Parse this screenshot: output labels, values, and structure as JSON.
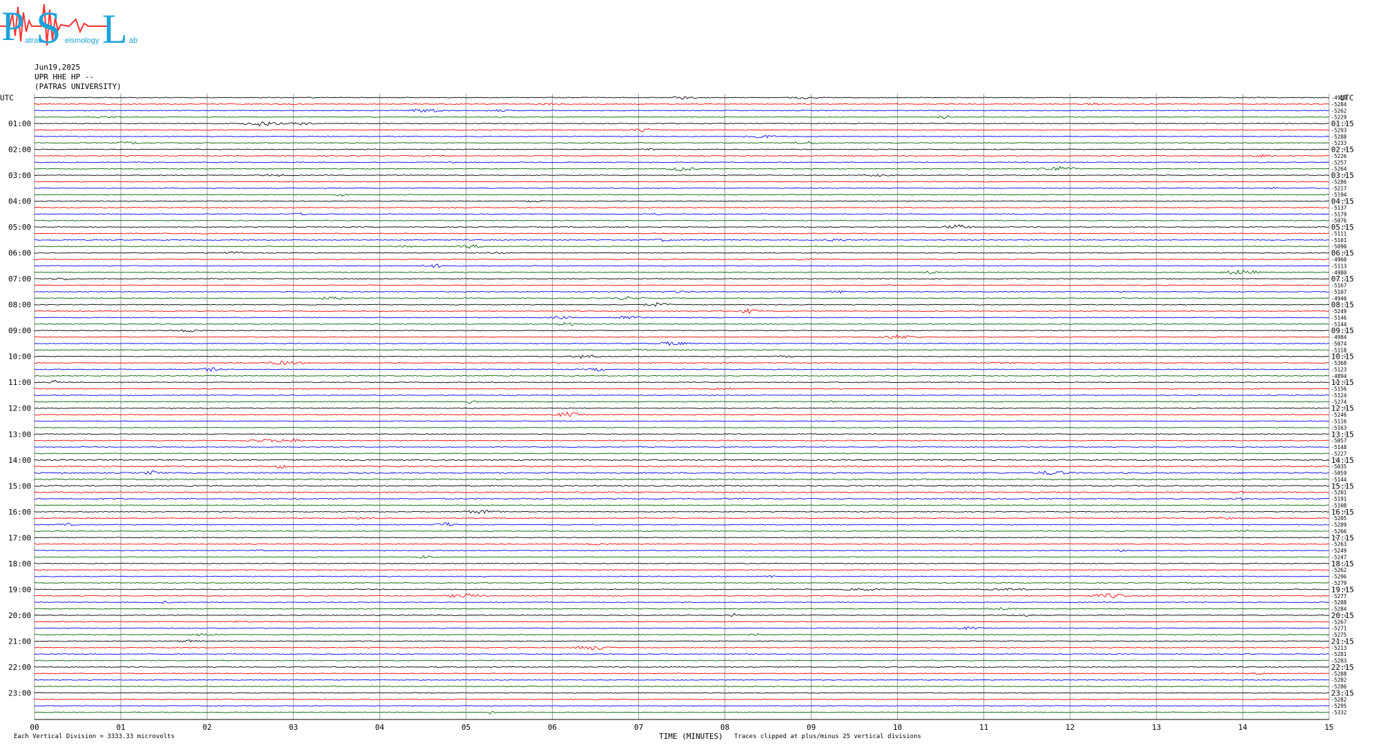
{
  "header": {
    "logo_letters": [
      "P",
      "S",
      "L"
    ],
    "logo_words": [
      "atras",
      "eismology",
      "ab"
    ],
    "date": "Jun19,2025",
    "station": "UPR HHE HP --",
    "institution": "(PATRAS UNIVERSITY)"
  },
  "footer": {
    "division_note": "Each Vertical Division = 3333.33 microvolts",
    "x_title": "TIME (MINUTES)",
    "clip_note": "Traces clipped at plus/minus 25 vertical divisions"
  },
  "colors": {
    "black": "#000000",
    "red": "#ff0000",
    "blue": "#0000ff",
    "green": "#006400",
    "grid": "#9a9a9a",
    "logo_blue": "#1aa3d9",
    "logo_red": "#ff3333"
  },
  "chart_data": {
    "type": "line",
    "title": "",
    "xlabel": "TIME (MINUTES)",
    "ylabel": "UTC",
    "xlim": [
      0,
      15
    ],
    "x_ticks": [
      "00",
      "01",
      "02",
      "03",
      "04",
      "05",
      "06",
      "07",
      "08",
      "09",
      "10",
      "11",
      "12",
      "13",
      "14",
      "15"
    ],
    "left_axis_label": "UTC",
    "right_axis_label": "UTC",
    "left_hour_labels": [
      "01:00",
      "02:00",
      "03:00",
      "04:00",
      "05:00",
      "06:00",
      "07:00",
      "08:00",
      "09:00",
      "10:00",
      "11:00",
      "12:00",
      "13:00",
      "14:00",
      "15:00",
      "16:00",
      "17:00",
      "18:00",
      "19:00",
      "20:00",
      "21:00",
      "22:00",
      "23:00"
    ],
    "right_hour_labels": [
      "01:15",
      "02:15",
      "03:15",
      "04:15",
      "05:15",
      "06:15",
      "07:15",
      "08:15",
      "09:15",
      "10:15",
      "11:15",
      "12:15",
      "13:15",
      "14:15",
      "15:15",
      "16:15",
      "17:15",
      "18:15",
      "19:15",
      "20:15",
      "21:15",
      "22:15",
      "23:15"
    ],
    "trace_color_cycle": [
      "black",
      "red",
      "blue",
      "green"
    ],
    "trace_count": 96,
    "trace_offsets": [
      "-4919",
      "-5284",
      "-5262",
      "-5229",
      "-5253",
      "-5293",
      "-5288",
      "-5233",
      "-5258",
      "-5226",
      "-5257",
      "-5264",
      "-5248",
      "-5286",
      "-5217",
      "-5194",
      "-5165",
      "-5137",
      "-5179",
      "-5076",
      "-5135",
      "-5111",
      "-5101",
      "-5090",
      "-5026",
      "-4960",
      "-5113",
      "-4980",
      "-5112",
      "-5167",
      "-5107",
      "-4940",
      "-5161",
      "-5249",
      "-5146",
      "-5144",
      "-5023",
      "-4984",
      "-5074",
      "-5118",
      "-5079",
      "-5368",
      "-5123",
      "-4894",
      "-4930",
      "-5156",
      "-5124",
      "-5274",
      "-5098",
      "-5246",
      "-5116",
      "-5163",
      "-5043",
      "-5057",
      "-5148",
      "-5227",
      "-4971",
      "-5035",
      "-5059",
      "-5144",
      "-5183",
      "-5201",
      "-5191",
      "-5108",
      "-5076",
      "-5205",
      "-5289",
      "-5266",
      "-5281",
      "-5263",
      "-5249",
      "-5247",
      "-5262",
      "-5262",
      "-5296",
      "-5279",
      "-5276",
      "-5277",
      "-5288",
      "-5284",
      "-5264",
      "-5267",
      "-5271",
      "-5275",
      "-5284",
      "-5213",
      "-5281",
      "-5283",
      "-5285",
      "-5288",
      "-5282",
      "-5286",
      "-5281",
      "-5282",
      "-5295",
      "-5332"
    ]
  }
}
